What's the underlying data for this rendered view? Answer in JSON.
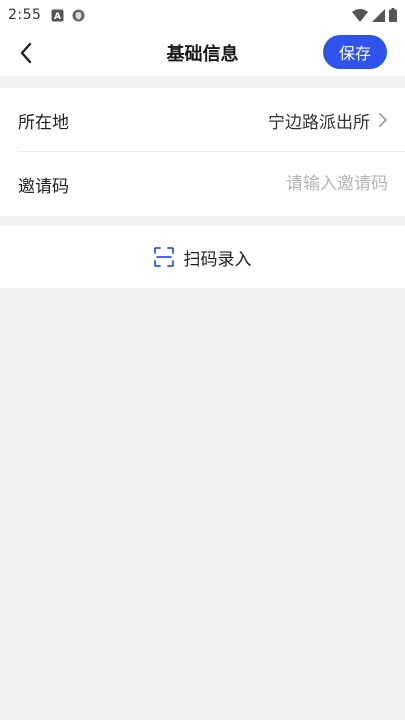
{
  "status_bar": {
    "time": "2:55",
    "icons": [
      "notification-a-icon",
      "shield-app-icon",
      "wifi-icon",
      "signal-icon",
      "battery-icon"
    ]
  },
  "header": {
    "title": "基础信息",
    "save_label": "保存",
    "accent_color": "#2f54eb"
  },
  "form": {
    "location": {
      "label": "所在地",
      "value": "宁边路派出所"
    },
    "invite_code": {
      "label": "邀请码",
      "value": "",
      "placeholder": "请输入邀请码"
    }
  },
  "scan": {
    "label": "扫码录入"
  }
}
